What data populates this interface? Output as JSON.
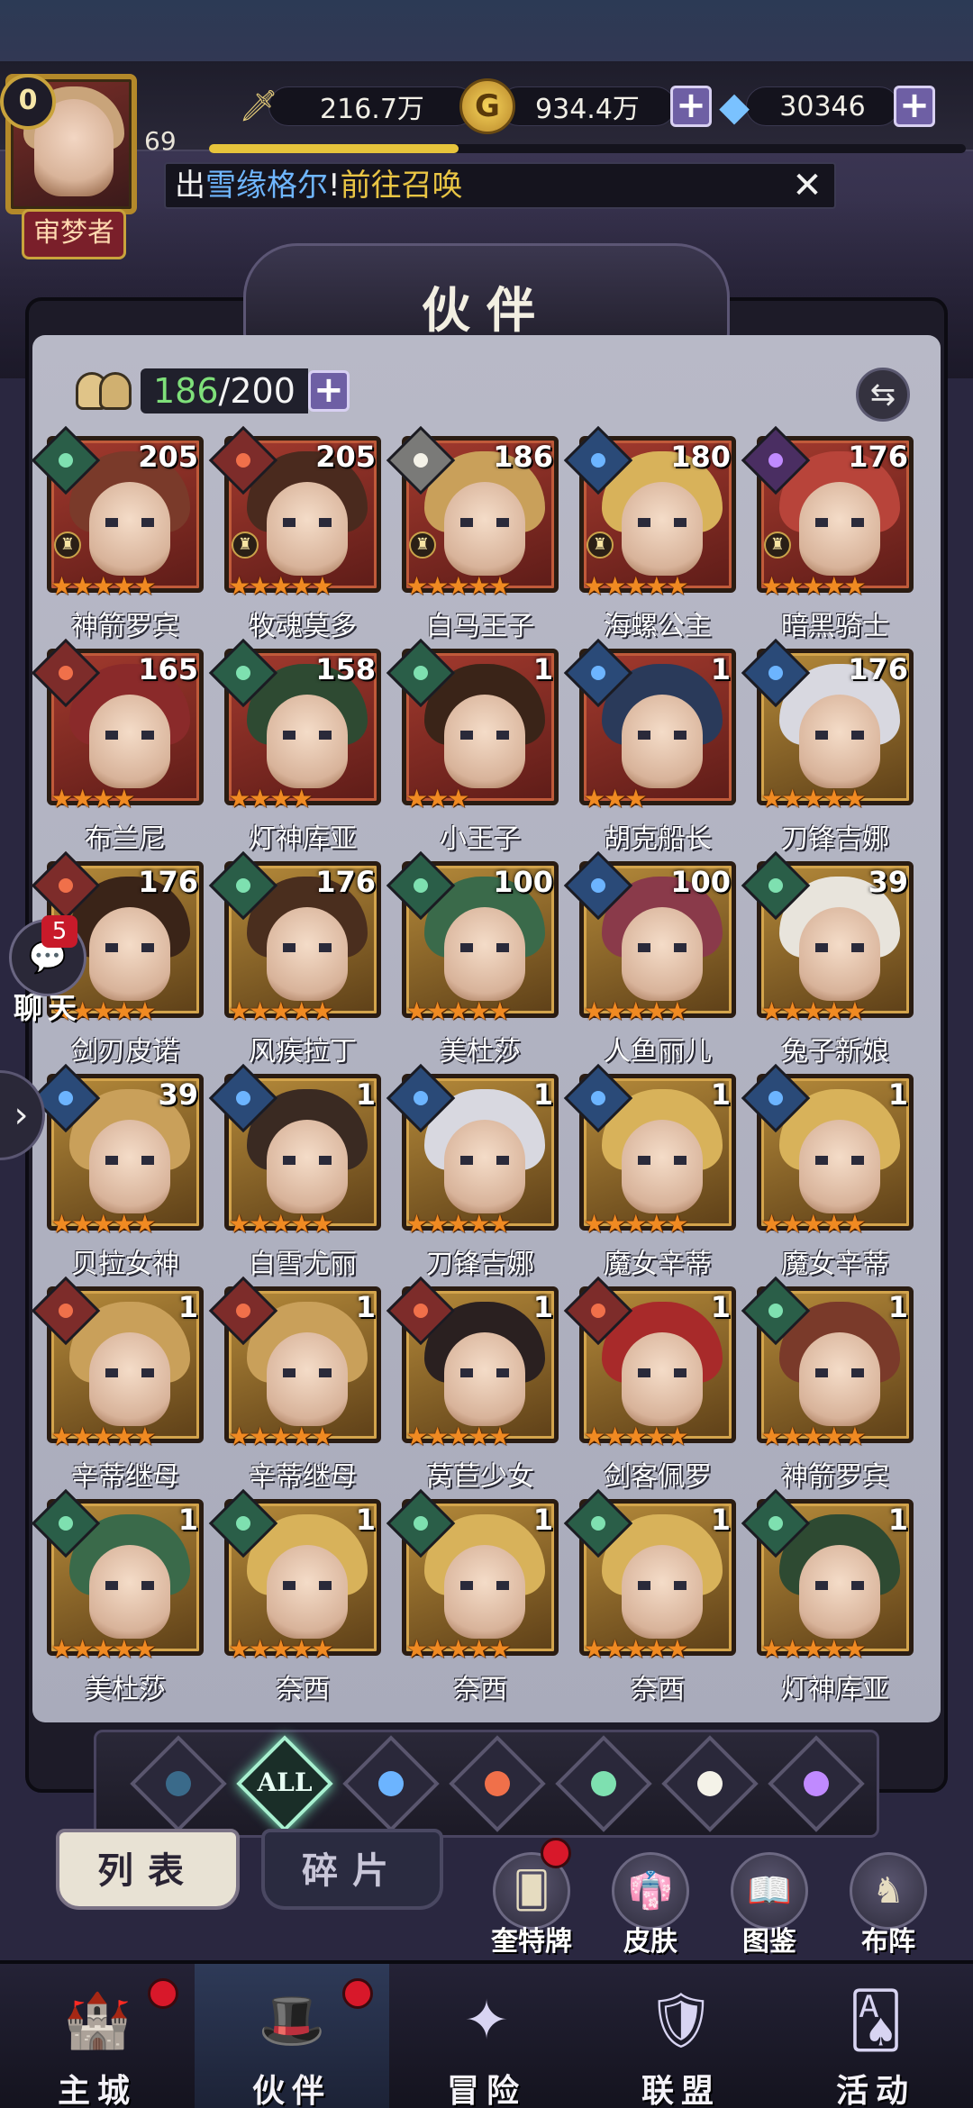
{
  "player": {
    "vip_level": "0",
    "level": "69",
    "title": "审梦者",
    "xp_progress": 0.33
  },
  "resources": {
    "power": "216.7万",
    "gold": "934.4万",
    "gems": "30346",
    "plus": "+"
  },
  "marquee": {
    "prefix": "出",
    "hero": "雪缘格尔",
    "sep": "!",
    "link": "前往召唤",
    "close": "✕"
  },
  "panel": {
    "title": "伙伴",
    "owned": "186",
    "capacity": "/200",
    "sort_icon": "⇆"
  },
  "heroes": [
    {
      "name": "神箭罗宾",
      "level": "205",
      "element": "wind",
      "stars": 5,
      "frame": "red",
      "tower": true,
      "hair": "#7a3a2a"
    },
    {
      "name": "牧魂莫多",
      "level": "205",
      "element": "fire",
      "stars": 5,
      "frame": "red",
      "tower": true,
      "hair": "#4a2a1e"
    },
    {
      "name": "白马王子",
      "level": "186",
      "element": "light",
      "stars": 5,
      "frame": "red",
      "tower": true,
      "hair": "#c9a05a"
    },
    {
      "name": "海螺公主",
      "level": "180",
      "element": "water",
      "stars": 5,
      "frame": "red",
      "tower": true,
      "hair": "#d8b25a"
    },
    {
      "name": "暗黑骑士",
      "level": "176",
      "element": "dark",
      "stars": 5,
      "frame": "red",
      "tower": true,
      "hair": "#b8443a"
    },
    {
      "name": "布兰尼",
      "level": "165",
      "element": "fire",
      "stars": 4,
      "frame": "red",
      "tower": false,
      "hair": "#8a2a2a"
    },
    {
      "name": "灯神库亚",
      "level": "158",
      "element": "wind",
      "stars": 4,
      "frame": "red",
      "tower": false,
      "hair": "#2e4a32"
    },
    {
      "name": "小王子",
      "level": "1",
      "element": "wind",
      "stars": 3,
      "frame": "red",
      "tower": false,
      "hair": "#3a2418"
    },
    {
      "name": "胡克船长",
      "level": "1",
      "element": "water",
      "stars": 3,
      "frame": "red",
      "tower": false,
      "hair": "#2a3a5a"
    },
    {
      "name": "刀锋吉娜",
      "level": "176",
      "element": "water",
      "stars": 5,
      "frame": "gold",
      "tower": false,
      "hair": "#d8d8e0"
    },
    {
      "name": "剑刃皮诺",
      "level": "176",
      "element": "fire",
      "stars": 5,
      "frame": "gold",
      "tower": false,
      "hair": "#3a2418"
    },
    {
      "name": "风疾拉丁",
      "level": "176",
      "element": "wind",
      "stars": 5,
      "frame": "gold",
      "tower": false,
      "hair": "#4a2e1e"
    },
    {
      "name": "美杜莎",
      "level": "100",
      "element": "wind",
      "stars": 5,
      "frame": "gold",
      "tower": false,
      "hair": "#3a6a4a"
    },
    {
      "name": "人鱼丽儿",
      "level": "100",
      "element": "water",
      "stars": 5,
      "frame": "gold",
      "tower": false,
      "hair": "#8a3a4a"
    },
    {
      "name": "兔子新娘",
      "level": "39",
      "element": "wind",
      "stars": 5,
      "frame": "gold",
      "tower": false,
      "hair": "#e8e4dc"
    },
    {
      "name": "贝拉女神",
      "level": "39",
      "element": "water",
      "stars": 5,
      "frame": "gold",
      "tower": false,
      "hair": "#c9a05a"
    },
    {
      "name": "白雪尤丽",
      "level": "1",
      "element": "water",
      "stars": 5,
      "frame": "gold",
      "tower": false,
      "hair": "#3a2a22"
    },
    {
      "name": "刀锋吉娜",
      "level": "1",
      "element": "water",
      "stars": 5,
      "frame": "gold",
      "tower": false,
      "hair": "#d8d8e0"
    },
    {
      "name": "魔女辛蒂",
      "level": "1",
      "element": "water",
      "stars": 5,
      "frame": "gold",
      "tower": false,
      "hair": "#d8b25a"
    },
    {
      "name": "魔女辛蒂",
      "level": "1",
      "element": "water",
      "stars": 5,
      "frame": "gold",
      "tower": false,
      "hair": "#d8b25a"
    },
    {
      "name": "辛蒂继母",
      "level": "1",
      "element": "fire",
      "stars": 5,
      "frame": "gold",
      "tower": false,
      "hair": "#c9a05a"
    },
    {
      "name": "辛蒂继母",
      "level": "1",
      "element": "fire",
      "stars": 5,
      "frame": "gold",
      "tower": false,
      "hair": "#c9a05a"
    },
    {
      "name": "莴苣少女",
      "level": "1",
      "element": "fire",
      "stars": 5,
      "frame": "gold",
      "tower": false,
      "hair": "#2a2020"
    },
    {
      "name": "剑客佩罗",
      "level": "1",
      "element": "fire",
      "stars": 5,
      "frame": "gold",
      "tower": false,
      "hair": "#a82a2a"
    },
    {
      "name": "神箭罗宾",
      "level": "1",
      "element": "wind",
      "stars": 5,
      "frame": "gold",
      "tower": false,
      "hair": "#7a3a2a"
    },
    {
      "name": "美杜莎",
      "level": "1",
      "element": "wind",
      "stars": 5,
      "frame": "gold",
      "tower": false,
      "hair": "#3a6a4a"
    },
    {
      "name": "奈西",
      "level": "1",
      "element": "wind",
      "stars": 5,
      "frame": "gold",
      "tower": false,
      "hair": "#d8b25a"
    },
    {
      "name": "奈西",
      "level": "1",
      "element": "wind",
      "stars": 5,
      "frame": "gold",
      "tower": false,
      "hair": "#d8b25a"
    },
    {
      "name": "奈西",
      "level": "1",
      "element": "wind",
      "stars": 5,
      "frame": "gold",
      "tower": false,
      "hair": "#d8b25a"
    },
    {
      "name": "灯神库亚",
      "level": "1",
      "element": "wind",
      "stars": 5,
      "frame": "gold",
      "tower": false,
      "hair": "#2e4a32"
    }
  ],
  "filters": [
    {
      "id": "abyss",
      "color": "#3a6a8a"
    },
    {
      "id": "all",
      "label": "ALL",
      "selected": true
    },
    {
      "id": "water",
      "color": "#6cb4ff"
    },
    {
      "id": "fire",
      "color": "#f0704a"
    },
    {
      "id": "wind",
      "color": "#7ee0b0"
    },
    {
      "id": "light",
      "color": "#f4f2e8"
    },
    {
      "id": "dark",
      "color": "#c08aff"
    }
  ],
  "tabs": {
    "list": "列表",
    "fragments": "碎片"
  },
  "shortcuts": [
    {
      "label": "奎特牌",
      "icon": "card-icon",
      "badge": true
    },
    {
      "label": "皮肤",
      "icon": "skin-icon",
      "badge": false
    },
    {
      "label": "图鉴",
      "icon": "codex-icon",
      "badge": false
    },
    {
      "label": "布阵",
      "icon": "formation-icon",
      "badge": false
    }
  ],
  "chat": {
    "label": "聊天",
    "unread": "5"
  },
  "nav": [
    {
      "label": "主城",
      "badge": true,
      "active": false
    },
    {
      "label": "伙伴",
      "badge": true,
      "active": true
    },
    {
      "label": "冒险",
      "badge": false,
      "active": false
    },
    {
      "label": "联盟",
      "badge": false,
      "active": false
    },
    {
      "label": "活动",
      "badge": false,
      "active": false
    }
  ]
}
